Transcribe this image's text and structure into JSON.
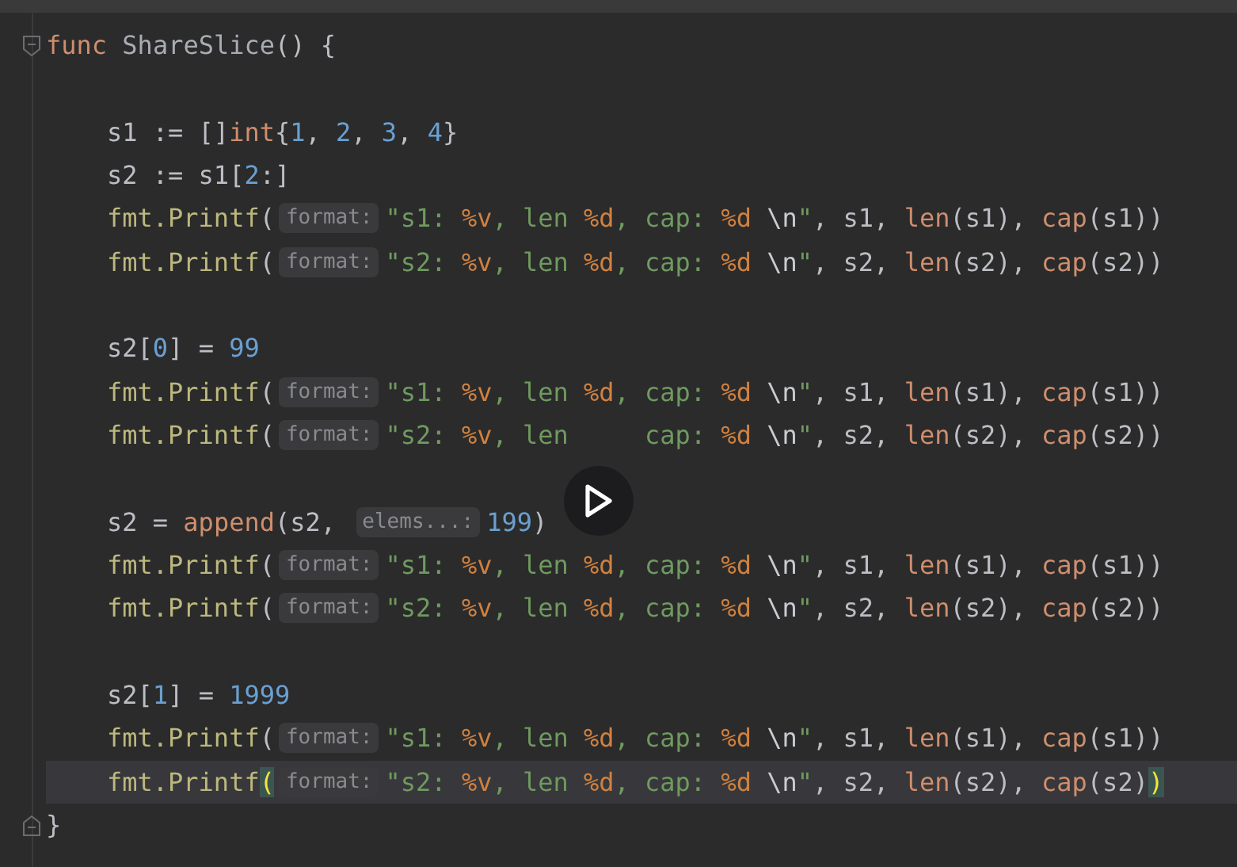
{
  "editor": {
    "lines": [
      {
        "current": false,
        "segments": [
          {
            "kind": "code",
            "tokens": [
              {
                "kind": "keyword",
                "text": "func "
              },
              {
                "kind": "name",
                "text": "ShareSlice"
              },
              {
                "kind": "plain",
                "text": "() {"
              }
            ]
          }
        ],
        "children": [
          {
            "current": false
          },
          {
            "current": false,
            "segments": [
              {
                "kind": "code",
                "tokens": [
                  {
                    "kind": "plain",
                    "text": "s1 := []"
                  },
                  {
                    "kind": "keyword",
                    "text": "int"
                  },
                  {
                    "kind": "plain",
                    "text": "{"
                  },
                  {
                    "kind": "number",
                    "text": "1"
                  },
                  {
                    "kind": "plain",
                    "text": ", "
                  },
                  {
                    "kind": "number",
                    "text": "2"
                  },
                  {
                    "kind": "plain",
                    "text": ", "
                  },
                  {
                    "kind": "number",
                    "text": "3"
                  },
                  {
                    "kind": "plain",
                    "text": ", "
                  },
                  {
                    "kind": "number",
                    "text": "4"
                  },
                  {
                    "kind": "plain",
                    "text": "}"
                  }
                ]
              }
            ]
          },
          {
            "current": false,
            "segments": [
              {
                "kind": "code",
                "tokens": [
                  {
                    "kind": "plain",
                    "text": "s2 := s1["
                  },
                  {
                    "kind": "number",
                    "text": "2"
                  },
                  {
                    "kind": "plain",
                    "text": ":]"
                  }
                ]
              }
            ]
          },
          {
            "current": false,
            "segments": [
              {
                "kind": "code",
                "tokens": [
                  {
                    "kind": "call",
                    "text": "fmt.Printf"
                  },
                  {
                    "kind": "plain",
                    "text": "("
                  }
                ]
              },
              {
                "kind": "hint",
                "text": "format:"
              },
              {
                "kind": "code",
                "tokens": [
                  {
                    "kind": "string",
                    "text": "\"s1: "
                  },
                  {
                    "kind": "verb",
                    "text": "%v"
                  },
                  {
                    "kind": "string",
                    "text": ", len "
                  },
                  {
                    "kind": "verb",
                    "text": "%d"
                  },
                  {
                    "kind": "string",
                    "text": ", cap: "
                  },
                  {
                    "kind": "verb",
                    "text": "%d"
                  },
                  {
                    "kind": "escape",
                    "text": " \\n"
                  },
                  {
                    "kind": "string",
                    "text": "\""
                  },
                  {
                    "kind": "plain",
                    "text": ", s1, "
                  },
                  {
                    "kind": "builtin",
                    "text": "len"
                  },
                  {
                    "kind": "plain",
                    "text": "(s1), "
                  },
                  {
                    "kind": "builtin",
                    "text": "cap"
                  },
                  {
                    "kind": "plain",
                    "text": "(s1))"
                  }
                ]
              }
            ]
          },
          {
            "current": false,
            "segments": [
              {
                "kind": "code",
                "tokens": [
                  {
                    "kind": "call",
                    "text": "fmt.Printf"
                  },
                  {
                    "kind": "plain",
                    "text": "("
                  }
                ]
              },
              {
                "kind": "hint",
                "text": "format:"
              },
              {
                "kind": "code",
                "tokens": [
                  {
                    "kind": "string",
                    "text": "\"s2: "
                  },
                  {
                    "kind": "verb",
                    "text": "%v"
                  },
                  {
                    "kind": "string",
                    "text": ", len "
                  },
                  {
                    "kind": "verb",
                    "text": "%d"
                  },
                  {
                    "kind": "string",
                    "text": ", cap: "
                  },
                  {
                    "kind": "verb",
                    "text": "%d"
                  },
                  {
                    "kind": "escape",
                    "text": " \\n"
                  },
                  {
                    "kind": "string",
                    "text": "\""
                  },
                  {
                    "kind": "plain",
                    "text": ", s2, "
                  },
                  {
                    "kind": "builtin",
                    "text": "len"
                  },
                  {
                    "kind": "plain",
                    "text": "(s2), "
                  },
                  {
                    "kind": "builtin",
                    "text": "cap"
                  },
                  {
                    "kind": "plain",
                    "text": "(s2))"
                  }
                ]
              }
            ]
          },
          {
            "current": false
          },
          {
            "current": false,
            "segments": [
              {
                "kind": "code",
                "tokens": [
                  {
                    "kind": "plain",
                    "text": "s2["
                  },
                  {
                    "kind": "number",
                    "text": "0"
                  },
                  {
                    "kind": "plain",
                    "text": "] = "
                  },
                  {
                    "kind": "number",
                    "text": "99"
                  }
                ]
              }
            ]
          },
          {
            "current": false,
            "segments": [
              {
                "kind": "code",
                "tokens": [
                  {
                    "kind": "call",
                    "text": "fmt.Printf"
                  },
                  {
                    "kind": "plain",
                    "text": "("
                  }
                ]
              },
              {
                "kind": "hint",
                "text": "format:"
              },
              {
                "kind": "code",
                "tokens": [
                  {
                    "kind": "string",
                    "text": "\"s1: "
                  },
                  {
                    "kind": "verb",
                    "text": "%v"
                  },
                  {
                    "kind": "string",
                    "text": ", len "
                  },
                  {
                    "kind": "verb",
                    "text": "%d"
                  },
                  {
                    "kind": "string",
                    "text": ", cap: "
                  },
                  {
                    "kind": "verb",
                    "text": "%d"
                  },
                  {
                    "kind": "escape",
                    "text": " \\n"
                  },
                  {
                    "kind": "string",
                    "text": "\""
                  },
                  {
                    "kind": "plain",
                    "text": ", s1, "
                  },
                  {
                    "kind": "builtin",
                    "text": "len"
                  },
                  {
                    "kind": "plain",
                    "text": "(s1), "
                  },
                  {
                    "kind": "builtin",
                    "text": "cap"
                  },
                  {
                    "kind": "plain",
                    "text": "(s1))"
                  }
                ]
              }
            ]
          },
          {
            "current": false,
            "segments": [
              {
                "kind": "code",
                "tokens": [
                  {
                    "kind": "call",
                    "text": "fmt.Printf"
                  },
                  {
                    "kind": "plain",
                    "text": "("
                  }
                ]
              },
              {
                "kind": "hint",
                "text": "format:"
              },
              {
                "kind": "code",
                "tokens": [
                  {
                    "kind": "string",
                    "text": "\"s2: "
                  },
                  {
                    "kind": "verb",
                    "text": "%v"
                  },
                  {
                    "kind": "string",
                    "text": ", len"
                  }
                ]
              },
              {
                "kind": "player"
              },
              {
                "kind": "code",
                "tokens": [
                  {
                    "kind": "string",
                    "text": " cap: "
                  },
                  {
                    "kind": "verb",
                    "text": "%d"
                  },
                  {
                    "kind": "escape",
                    "text": " \\n"
                  },
                  {
                    "kind": "string",
                    "text": "\""
                  },
                  {
                    "kind": "plain",
                    "text": ", s2, "
                  },
                  {
                    "kind": "builtin",
                    "text": "len"
                  },
                  {
                    "kind": "plain",
                    "text": "(s2), "
                  },
                  {
                    "kind": "builtin",
                    "text": "cap"
                  },
                  {
                    "kind": "plain",
                    "text": "(s2))"
                  }
                ]
              }
            ]
          },
          {
            "current": false
          },
          {
            "current": false,
            "segments": [
              {
                "kind": "code",
                "tokens": [
                  {
                    "kind": "plain",
                    "text": "s2 = "
                  },
                  {
                    "kind": "builtin",
                    "text": "append"
                  },
                  {
                    "kind": "plain",
                    "text": "(s2, "
                  }
                ]
              },
              {
                "kind": "hint",
                "text": "elems...:"
              },
              {
                "kind": "code",
                "tokens": [
                  {
                    "kind": "number",
                    "text": "199"
                  },
                  {
                    "kind": "plain",
                    "text": ")"
                  }
                ]
              }
            ]
          },
          {
            "current": false,
            "segments": [
              {
                "kind": "code",
                "tokens": [
                  {
                    "kind": "call",
                    "text": "fmt.Printf"
                  },
                  {
                    "kind": "plain",
                    "text": "("
                  }
                ]
              },
              {
                "kind": "hint",
                "text": "format:"
              },
              {
                "kind": "code",
                "tokens": [
                  {
                    "kind": "string",
                    "text": "\"s1: "
                  },
                  {
                    "kind": "verb",
                    "text": "%v"
                  },
                  {
                    "kind": "string",
                    "text": ", len "
                  },
                  {
                    "kind": "verb",
                    "text": "%d"
                  },
                  {
                    "kind": "string",
                    "text": ", cap: "
                  },
                  {
                    "kind": "verb",
                    "text": "%d"
                  },
                  {
                    "kind": "escape",
                    "text": " \\n"
                  },
                  {
                    "kind": "string",
                    "text": "\""
                  },
                  {
                    "kind": "plain",
                    "text": ", s1, "
                  },
                  {
                    "kind": "builtin",
                    "text": "len"
                  },
                  {
                    "kind": "plain",
                    "text": "(s1), "
                  },
                  {
                    "kind": "builtin",
                    "text": "cap"
                  },
                  {
                    "kind": "plain",
                    "text": "(s1))"
                  }
                ]
              }
            ]
          },
          {
            "current": false,
            "segments": [
              {
                "kind": "code",
                "tokens": [
                  {
                    "kind": "call",
                    "text": "fmt.Printf"
                  },
                  {
                    "kind": "plain",
                    "text": "("
                  }
                ]
              },
              {
                "kind": "hint",
                "text": "format:"
              },
              {
                "kind": "code",
                "tokens": [
                  {
                    "kind": "string",
                    "text": "\"s2: "
                  },
                  {
                    "kind": "verb",
                    "text": "%v"
                  },
                  {
                    "kind": "string",
                    "text": ", len "
                  },
                  {
                    "kind": "verb",
                    "text": "%d"
                  },
                  {
                    "kind": "string",
                    "text": ", cap: "
                  },
                  {
                    "kind": "verb",
                    "text": "%d"
                  },
                  {
                    "kind": "escape",
                    "text": " \\n"
                  },
                  {
                    "kind": "string",
                    "text": "\""
                  },
                  {
                    "kind": "plain",
                    "text": ", s2, "
                  },
                  {
                    "kind": "builtin",
                    "text": "len"
                  },
                  {
                    "kind": "plain",
                    "text": "(s2), "
                  },
                  {
                    "kind": "builtin",
                    "text": "cap"
                  },
                  {
                    "kind": "plain",
                    "text": "(s2))"
                  }
                ]
              }
            ]
          },
          {
            "current": false
          },
          {
            "current": false,
            "segments": [
              {
                "kind": "code",
                "tokens": [
                  {
                    "kind": "plain",
                    "text": "s2["
                  },
                  {
                    "kind": "number",
                    "text": "1"
                  },
                  {
                    "kind": "plain",
                    "text": "] = "
                  },
                  {
                    "kind": "number",
                    "text": "1999"
                  }
                ]
              }
            ]
          },
          {
            "current": false,
            "segments": [
              {
                "kind": "code",
                "tokens": [
                  {
                    "kind": "call",
                    "text": "fmt.Printf"
                  },
                  {
                    "kind": "plain",
                    "text": "("
                  }
                ]
              },
              {
                "kind": "hint",
                "text": "format:"
              },
              {
                "kind": "code",
                "tokens": [
                  {
                    "kind": "string",
                    "text": "\"s1: "
                  },
                  {
                    "kind": "verb",
                    "text": "%v"
                  },
                  {
                    "kind": "string",
                    "text": ", len "
                  },
                  {
                    "kind": "verb",
                    "text": "%d"
                  },
                  {
                    "kind": "string",
                    "text": ", cap: "
                  },
                  {
                    "kind": "verb",
                    "text": "%d"
                  },
                  {
                    "kind": "escape",
                    "text": " \\n"
                  },
                  {
                    "kind": "string",
                    "text": "\""
                  },
                  {
                    "kind": "plain",
                    "text": ", s1, "
                  },
                  {
                    "kind": "builtin",
                    "text": "len"
                  },
                  {
                    "kind": "plain",
                    "text": "(s1), "
                  },
                  {
                    "kind": "builtin",
                    "text": "cap"
                  },
                  {
                    "kind": "plain",
                    "text": "(s1))"
                  }
                ]
              }
            ]
          },
          {
            "current": true,
            "segments": [
              {
                "kind": "code",
                "tokens": [
                  {
                    "kind": "call",
                    "text": "fmt.Printf"
                  },
                  {
                    "kind": "match",
                    "text": "("
                  }
                ]
              },
              {
                "kind": "hint",
                "text": "format:"
              },
              {
                "kind": "code",
                "tokens": [
                  {
                    "kind": "string",
                    "text": "\"s2: "
                  },
                  {
                    "kind": "verb",
                    "text": "%v"
                  },
                  {
                    "kind": "string",
                    "text": ", len "
                  },
                  {
                    "kind": "verb",
                    "text": "%d"
                  },
                  {
                    "kind": "string",
                    "text": ", cap: "
                  },
                  {
                    "kind": "verb",
                    "text": "%d"
                  },
                  {
                    "kind": "escape",
                    "text": " \\n"
                  },
                  {
                    "kind": "string",
                    "text": "\""
                  },
                  {
                    "kind": "plain",
                    "text": ", s2, "
                  },
                  {
                    "kind": "builtin",
                    "text": "len"
                  },
                  {
                    "kind": "plain",
                    "text": "(s2), "
                  },
                  {
                    "kind": "builtin",
                    "text": "cap"
                  },
                  {
                    "kind": "plain",
                    "text": "(s2)"
                  },
                  {
                    "kind": "match",
                    "text": ")"
                  }
                ]
              }
            ]
          }
        ]
      },
      {
        "current": false,
        "segments": [
          {
            "kind": "code",
            "tokens": [
              {
                "kind": "plain",
                "text": "}"
              }
            ]
          }
        ]
      }
    ]
  }
}
